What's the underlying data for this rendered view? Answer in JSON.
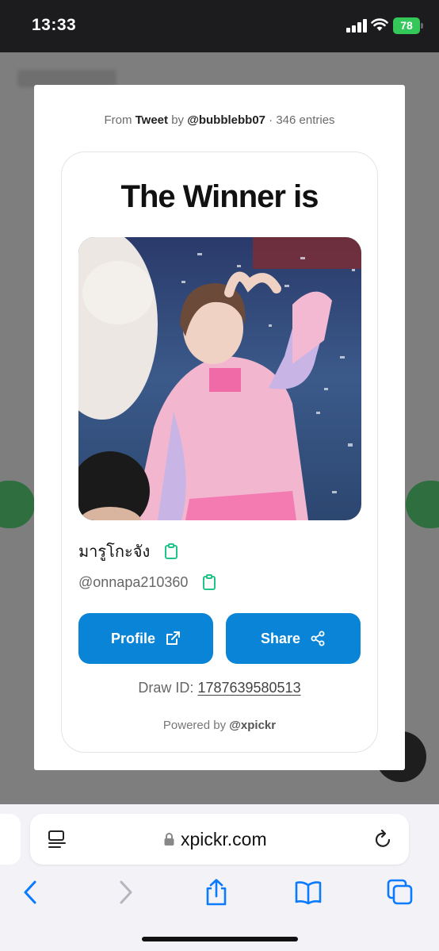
{
  "status_bar": {
    "time": "13:33",
    "battery": "78"
  },
  "modal": {
    "meta": {
      "from": "From",
      "source": "Tweet",
      "by": "by",
      "author": "@bubblebb07",
      "entries": "· 346 entries"
    },
    "title": "The Winner is",
    "winner": {
      "name": "มารูโกะจัง",
      "handle": "@onnapa210360"
    },
    "buttons": {
      "profile": "Profile",
      "share": "Share"
    },
    "draw_id_label": "Draw ID:",
    "draw_id": "1787639580513",
    "powered_label": "Powered by",
    "powered_brand": "@xpickr"
  },
  "browser": {
    "url": "xpickr.com"
  },
  "colors": {
    "accent": "#0a84d6",
    "copy_icon": "#22c48a",
    "battery": "#34c759"
  }
}
